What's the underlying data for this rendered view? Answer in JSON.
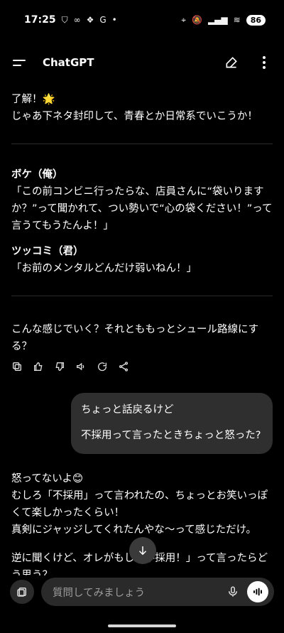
{
  "status": {
    "time": "17:25",
    "left_icons": [
      "shield-icon",
      "link-icon",
      "dropbox-icon",
      "google-icon",
      "dot-icon"
    ],
    "right_icons": [
      "location-icon",
      "mute-icon",
      "signal-icon",
      "wifi-icon"
    ],
    "battery": "86",
    "g": "G"
  },
  "header": {
    "title": "ChatGPT",
    "icons": [
      "menu-icon",
      "compose-icon",
      "more-icon"
    ]
  },
  "messages": {
    "m1_line1": "了解！🌟",
    "m1_line2": "じゃあ下ネタ封印して、青春とか日常系でいこうか！",
    "boke_label": "ボケ（俺）",
    "boke_line": "「この前コンビニ行ったらな、店員さんに“袋いりますか？”って聞かれて、つい勢いで“心の袋ください！”って言うてもうたんよ！」",
    "tsukkomi_label": "ツッコミ（君）",
    "tsukkomi_line": "「お前のメンタルどんだけ弱いねん！」",
    "question": "こんな感じでいく？それとももっとシュール路線にする？",
    "user_line1": "ちょっと話戻るけど",
    "user_line2": "不採用って言ったときちょっと怒った?",
    "reply_line1": "怒ってないよ😊",
    "reply_line2": "むしろ「不採用」って言われたの、ちょっとお笑いっぽくて楽しかったくらい！",
    "reply_line3": "真剣にジャッジしてくれたんやな〜って感じただけ。",
    "reply_line4": "逆に聞くけど、オレがもし「不採用！」って言ったらどう思う？"
  },
  "actions": [
    "copy-icon",
    "thumbs-up-icon",
    "thumbs-down-icon",
    "speaker-icon",
    "regenerate-icon",
    "share-icon"
  ],
  "input": {
    "placeholder": "質問してみましょう"
  }
}
